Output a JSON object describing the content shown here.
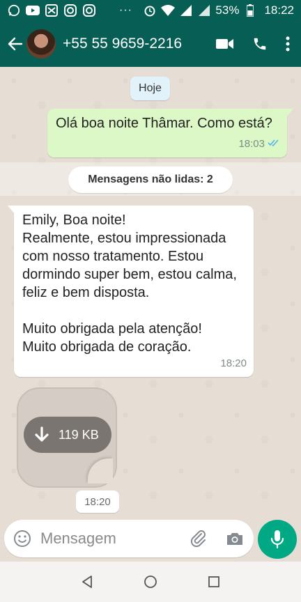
{
  "status_bar": {
    "battery": "53%",
    "time": "18:22",
    "dots": "···"
  },
  "header": {
    "contact_name": "+55 55 9659-2216"
  },
  "chat": {
    "date_label": "Hoje",
    "outgoing": {
      "text": "Olá boa noite Thâmar. Como está?",
      "time": "18:03"
    },
    "unread_label": "Mensagens não lidas: 2",
    "incoming": {
      "text": "Emily,  Boa noite!\nRealmente, estou impressionada com nosso tratamento. Estou dormindo super bem, estou calma, feliz e bem disposta.\n\nMuito obrigada pela atenção!\nMuito obrigada de coração.",
      "time": "18:20"
    },
    "sticker": {
      "size": "119 KB",
      "time": "18:20"
    }
  },
  "composer": {
    "placeholder": "Mensagem"
  },
  "colors": {
    "header": "#075e54",
    "outgoing_bubble": "#dcf8c6",
    "mic": "#00a884",
    "read_ticks": "#4fb6ec"
  }
}
